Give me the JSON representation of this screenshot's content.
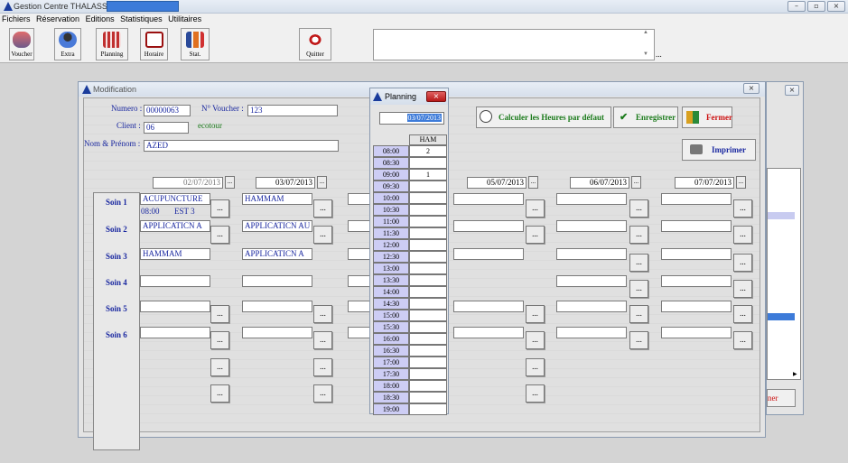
{
  "app": {
    "title": "Gestion Centre THALASSO :"
  },
  "menu": [
    "Fichiers",
    "Réservation",
    "Editions",
    "Statistiques",
    "Utilitaires"
  ],
  "toolbar": [
    {
      "label": "Voucher",
      "icon": "people-icon"
    },
    {
      "label": "Extra",
      "icon": "person-icon"
    },
    {
      "label": "Planning",
      "icon": "ticket-icon"
    },
    {
      "label": "Horaire",
      "icon": "clock-icon"
    },
    {
      "label": "Stat.",
      "icon": "bar-chart-icon"
    },
    {
      "label": "Quitter",
      "icon": "exit-icon"
    }
  ],
  "bigbox": {
    "text": "..."
  },
  "window": {
    "title": "Modification",
    "numero_label": "Numero :",
    "numero": "00000063",
    "voucher_label": "N° Voucher :",
    "voucher": "123",
    "client_label": "Client :",
    "client": "06",
    "client_name": "ecotour",
    "nom_label": "Nom & Prénom :",
    "nom": "AZED",
    "btn_calc": "Calculer les Heures par défaut",
    "btn_save": "Enregistrer",
    "btn_close": "Fermer",
    "btn_print": "Imprimer",
    "dates": [
      "02/07/2013",
      "03/07/2013",
      "",
      "05/07/2013",
      "06/07/2013",
      "07/07/2013"
    ],
    "soins": [
      "Soin 1",
      "Soin 2",
      "Soin 3",
      "Soin 4",
      "Soin 5",
      "Soin 6"
    ],
    "col1": [
      "ACUPUNCTURE",
      "APPLICATICN A",
      "HAMMAM",
      "",
      "",
      ""
    ],
    "col1_sub": {
      "time": "08:00",
      "code": "EST 3"
    },
    "col2": [
      "HAMMAM",
      "APPLICATICN AU",
      "APPLICATICN A",
      "",
      "",
      ""
    ],
    "dots": "...",
    "right_partial": "ner"
  },
  "planning": {
    "title": "Planning",
    "date": "03/07/2013",
    "col": "HAM",
    "rows": [
      {
        "t": "08:00",
        "v": "2"
      },
      {
        "t": "08:30",
        "v": ""
      },
      {
        "t": "09:00",
        "v": "1"
      },
      {
        "t": "09:30",
        "v": ""
      },
      {
        "t": "10:00",
        "v": ""
      },
      {
        "t": "10:30",
        "v": ""
      },
      {
        "t": "11:00",
        "v": ""
      },
      {
        "t": "11:30",
        "v": ""
      },
      {
        "t": "12:00",
        "v": ""
      },
      {
        "t": "12:30",
        "v": ""
      },
      {
        "t": "13:00",
        "v": ""
      },
      {
        "t": "13:30",
        "v": ""
      },
      {
        "t": "14:00",
        "v": ""
      },
      {
        "t": "14:30",
        "v": ""
      },
      {
        "t": "15:00",
        "v": ""
      },
      {
        "t": "15:30",
        "v": ""
      },
      {
        "t": "16:00",
        "v": ""
      },
      {
        "t": "16:30",
        "v": ""
      },
      {
        "t": "17:00",
        "v": ""
      },
      {
        "t": "17:30",
        "v": ""
      },
      {
        "t": "18:00",
        "v": ""
      },
      {
        "t": "18:30",
        "v": ""
      },
      {
        "t": "19:00",
        "v": ""
      }
    ]
  },
  "colors": {
    "accent": "#1a28a0",
    "title_hl": "#3d7bd9",
    "slot": "#cdcdf4",
    "close": "#cc1111",
    "save": "#1a7a1a"
  }
}
